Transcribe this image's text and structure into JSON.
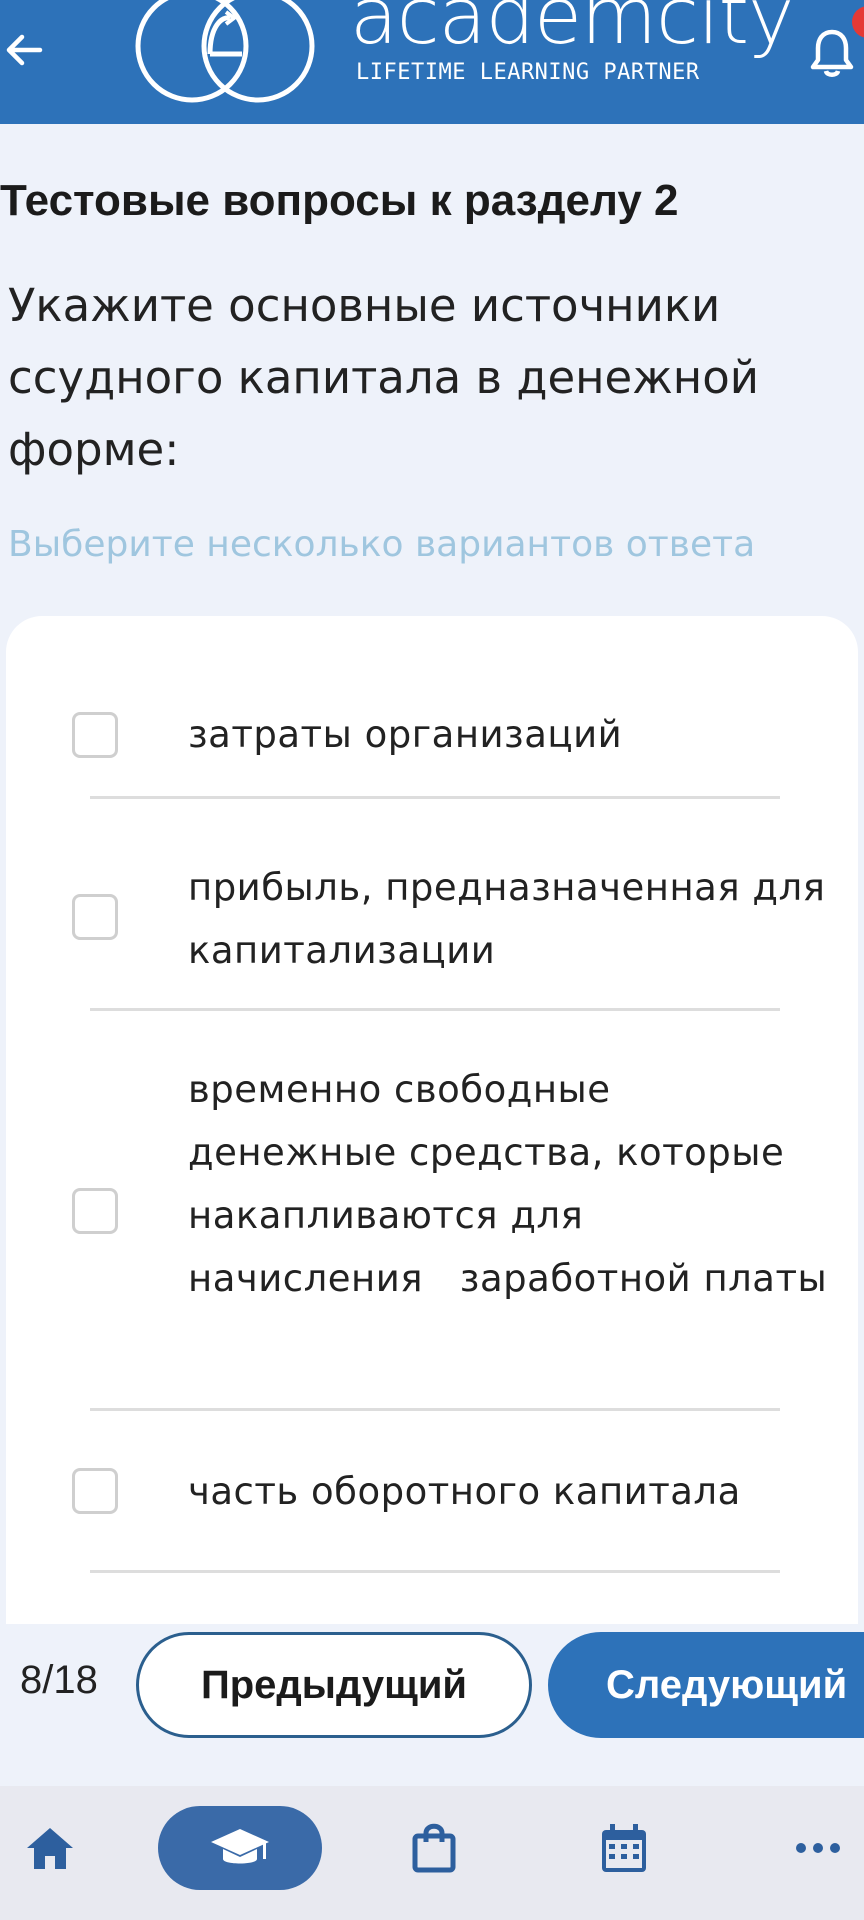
{
  "header": {
    "brand": "academcity",
    "tagline": "LIFETIME LEARNING PARTNER",
    "back_icon": "arrow-left-icon",
    "bell_icon": "bell-icon"
  },
  "section_title": "Тестовые вопросы к разделу 2",
  "question": "Укажите основные источники ссудного капитала в денежной форме:",
  "hint": "Выберите несколько вариантов ответа",
  "options": [
    {
      "text": "затраты организаций",
      "checked": false
    },
    {
      "text": "прибыль, предназначенная для капитализации",
      "checked": false
    },
    {
      "text": "временно свободные денежные средства, которые накапливаются для начисления   заработной платы",
      "checked": false
    },
    {
      "text": "часть оборотного капитала",
      "checked": false
    }
  ],
  "pager": {
    "counter": "8/18",
    "prev_label": "Предыдущий",
    "next_label": "Следующий"
  },
  "tabs": [
    {
      "icon": "home-icon",
      "active": false
    },
    {
      "icon": "graduation-cap-icon",
      "active": true
    },
    {
      "icon": "shopping-bag-icon",
      "active": false
    },
    {
      "icon": "calendar-icon",
      "active": false
    },
    {
      "icon": "more-icon",
      "active": false
    }
  ],
  "colors": {
    "brand_blue": "#2d72b9",
    "hint": "#9fc6df",
    "badge": "#e53935"
  }
}
